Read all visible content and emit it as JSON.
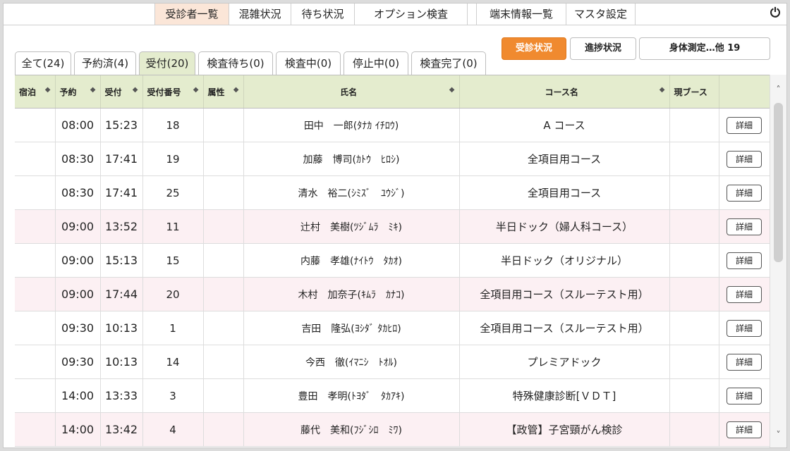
{
  "nav": {
    "items": [
      {
        "label": "受診者一覧",
        "active": true
      },
      {
        "label": "混雑状況"
      },
      {
        "label": "待ち状況"
      },
      {
        "label": "オプション検査"
      },
      {
        "label": "端末情報一覧"
      },
      {
        "label": "マスタ設定"
      }
    ],
    "power_icon": "⏻"
  },
  "actions": {
    "status_label": "受診状況",
    "progress_label": "進捗状況",
    "measure_label": "身体測定…他 19"
  },
  "tabs": [
    {
      "label": "全て(24)"
    },
    {
      "label": "予約済(4)"
    },
    {
      "label": "受付(20)",
      "active": true
    },
    {
      "label": "検査待ち(0)"
    },
    {
      "label": "検査中(0)"
    },
    {
      "label": "停止中(0)"
    },
    {
      "label": "検査完了(0)"
    }
  ],
  "table": {
    "headers": {
      "stay": "宿泊",
      "reservation": "予約",
      "reception": "受付",
      "reception_no": "受付番号",
      "attribute": "属性",
      "name": "氏名",
      "course": "コース名",
      "booth": "現ブース",
      "sort_icon": "◆"
    },
    "detail_label": "詳細",
    "rows": [
      {
        "stay": "",
        "reservation": "08:00",
        "reception": "15:23",
        "no": "18",
        "attr": "",
        "name": "田中　一郎(ﾀﾅｶ ｲﾁﾛｳ)",
        "course": "A コース",
        "booth": "",
        "pink": false
      },
      {
        "stay": "",
        "reservation": "08:30",
        "reception": "17:41",
        "no": "19",
        "attr": "",
        "name": "加藤　博司(ｶﾄｳ　ﾋﾛｼ)",
        "course": "全項目用コース",
        "booth": "",
        "pink": false
      },
      {
        "stay": "",
        "reservation": "08:30",
        "reception": "17:41",
        "no": "25",
        "attr": "",
        "name": "清水　裕二(ｼﾐｽﾞ　ﾕｳｼﾞ)",
        "course": "全項目用コース",
        "booth": "",
        "pink": false
      },
      {
        "stay": "",
        "reservation": "09:00",
        "reception": "13:52",
        "no": "11",
        "attr": "",
        "name": "辻村　美樹(ﾂｼﾞﾑﾗ　ﾐｷ)",
        "course": "半日ドック（婦人科コース）",
        "booth": "",
        "pink": true
      },
      {
        "stay": "",
        "reservation": "09:00",
        "reception": "15:13",
        "no": "15",
        "attr": "",
        "name": "内藤　孝雄(ﾅｲﾄｳ　ﾀｶｵ)",
        "course": "半日ドック（オリジナル）",
        "booth": "",
        "pink": false
      },
      {
        "stay": "",
        "reservation": "09:00",
        "reception": "17:44",
        "no": "20",
        "attr": "",
        "name": "木村　加奈子(ｷﾑﾗ　ｶﾅｺ)",
        "course": "全項目用コース（スルーテスト用）",
        "booth": "",
        "pink": true
      },
      {
        "stay": "",
        "reservation": "09:30",
        "reception": "10:13",
        "no": "1",
        "attr": "",
        "name": "吉田　隆弘(ﾖｼﾀﾞ ﾀｶﾋﾛ)",
        "course": "全項目用コース（スルーテスト用）",
        "booth": "",
        "pink": false
      },
      {
        "stay": "",
        "reservation": "09:30",
        "reception": "10:13",
        "no": "14",
        "attr": "",
        "name": "今西　徹(ｲﾏﾆｼ　ﾄｵﾙ)",
        "course": "プレミアドック",
        "booth": "",
        "pink": false
      },
      {
        "stay": "",
        "reservation": "14:00",
        "reception": "13:33",
        "no": "3",
        "attr": "",
        "name": "豊田　孝明(ﾄﾖﾀﾞ　ﾀｶｱｷ)",
        "course": "特殊健康診断[ＶＤＴ]",
        "booth": "",
        "pink": false
      },
      {
        "stay": "",
        "reservation": "14:00",
        "reception": "13:42",
        "no": "4",
        "attr": "",
        "name": "藤代　美和(ﾌｼﾞｼﾛ　ﾐﾜ)",
        "course": "【政管】子宮頸がん検診",
        "booth": "",
        "pink": true
      }
    ]
  },
  "scrollbar": {
    "up_icon": "˄",
    "down_icon": "˅"
  }
}
